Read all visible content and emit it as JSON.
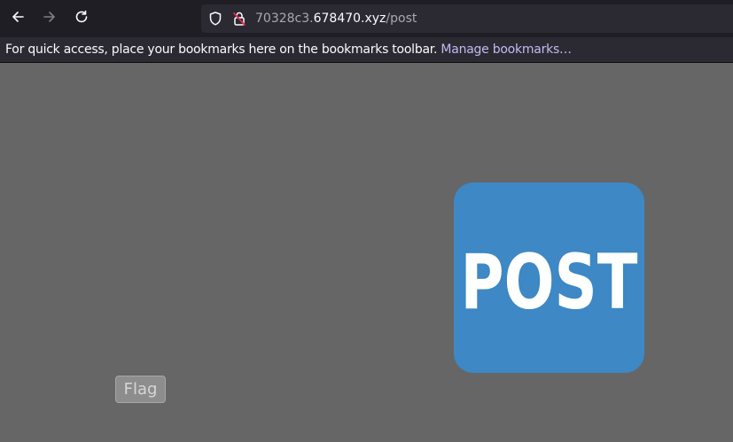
{
  "browser": {
    "back_icon": "arrow-left-icon",
    "forward_icon": "arrow-right-icon",
    "reload_icon": "reload-icon",
    "url": {
      "subdomain": "70328c3.",
      "host": "678470.xyz",
      "path": "/post"
    },
    "shield_icon": "shield-icon",
    "lock_icon": "insecure-lock-icon"
  },
  "bookmarks_bar": {
    "message": "For quick access, place your bookmarks here on the bookmarks toolbar.",
    "manage_link": "Manage bookmarks…"
  },
  "page": {
    "post_image_text": "POST",
    "post_image_color": "#3d88c5",
    "flag_button": "Flag"
  }
}
